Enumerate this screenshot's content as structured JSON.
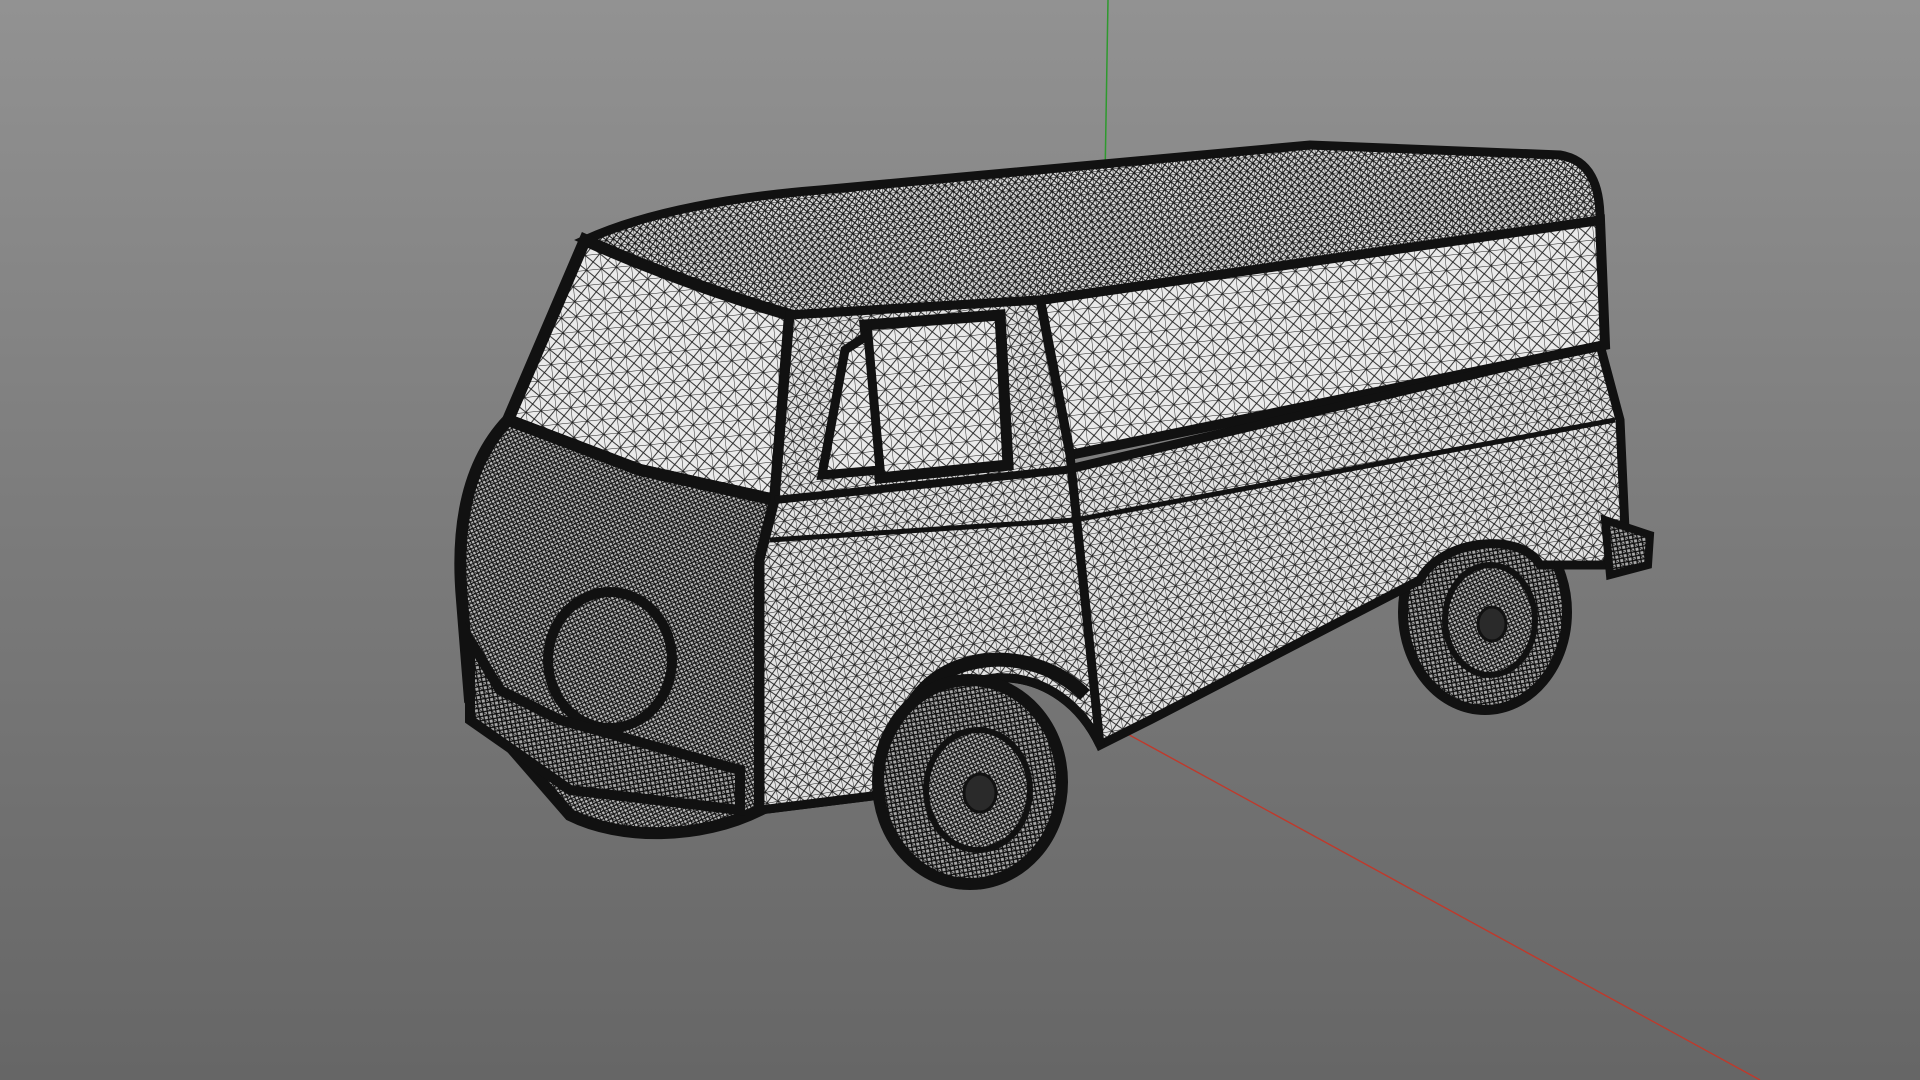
{
  "viewport": {
    "view_mode": "wireframe",
    "background_top": "#929292",
    "background_bottom": "#666666"
  },
  "axes": {
    "x_axis_color": "#c0392b",
    "y_axis_color": "#2e9a2e",
    "z_axis_color": "#3b3bb0"
  },
  "model": {
    "object": "van",
    "wire_color": "#111111",
    "surface_color": "#e6e6e6"
  }
}
